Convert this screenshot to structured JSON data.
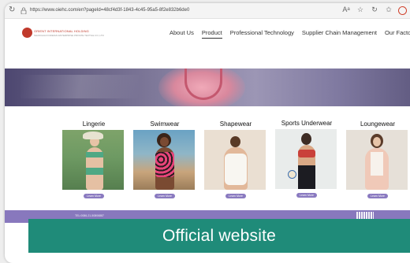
{
  "browser": {
    "url": "https://www.oiehc.com/en?pageId=48cf4d3f-1843-4c45-95a5-8f2e832b6de0",
    "reader_label": "Aᵃ",
    "icons": [
      "reload-icon",
      "lock-icon",
      "read-aloud-icon",
      "favorite-icon",
      "refresh-icon",
      "profile-icon"
    ]
  },
  "site": {
    "logo_line1": "ORIENT INTERNATIONAL HOLDING",
    "logo_line2": "SHANGHAI FOREIGN ENTERPRISE PRIVATE TEXTILE CO.,LTD",
    "nav": [
      "About Us",
      "Product",
      "Professional Technology",
      "Supplier Chain Management",
      "Our Factories"
    ],
    "active_nav": "Product"
  },
  "categories": [
    {
      "name": "Lingerie",
      "button": "Learn More"
    },
    {
      "name": "Swimwear",
      "button": "Learn More"
    },
    {
      "name": "Shapewear",
      "button": "Learn More"
    },
    {
      "name": "Sports Underwear",
      "button": "Learn More"
    },
    {
      "name": "Loungewear",
      "button": "Learn More"
    }
  ],
  "footer": {
    "tel": "TEL:0086-21-50806887"
  },
  "caption": "Official website",
  "colors": {
    "accent_purple": "#8878bd",
    "caption_green": "#1f8b79",
    "logo_red": "#c0392b"
  }
}
